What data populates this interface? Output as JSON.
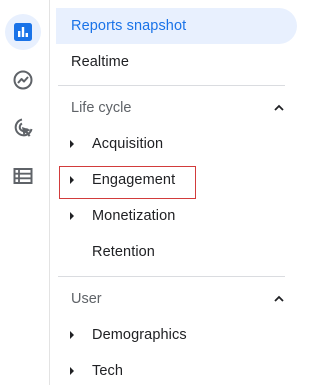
{
  "rail": {
    "icons": [
      {
        "name": "reports-icon",
        "active": true
      },
      {
        "name": "explore-icon",
        "active": false
      },
      {
        "name": "advertising-icon",
        "active": false
      },
      {
        "name": "configure-icon",
        "active": false
      }
    ]
  },
  "nav": {
    "reports_snapshot": "Reports snapshot",
    "realtime": "Realtime",
    "life_cycle": {
      "header": "Life cycle",
      "items": [
        {
          "label": "Acquisition",
          "expandable": true
        },
        {
          "label": "Engagement",
          "expandable": true,
          "highlighted": true
        },
        {
          "label": "Monetization",
          "expandable": true
        },
        {
          "label": "Retention",
          "expandable": false
        }
      ]
    },
    "user": {
      "header": "User",
      "items": [
        {
          "label": "Demographics",
          "expandable": true
        },
        {
          "label": "Tech",
          "expandable": true
        }
      ]
    }
  },
  "colors": {
    "accent": "#1a73e8",
    "active_bg": "#e8f0fe",
    "highlight_border": "#d23b3b",
    "text": "#202124",
    "muted": "#5f6368"
  }
}
